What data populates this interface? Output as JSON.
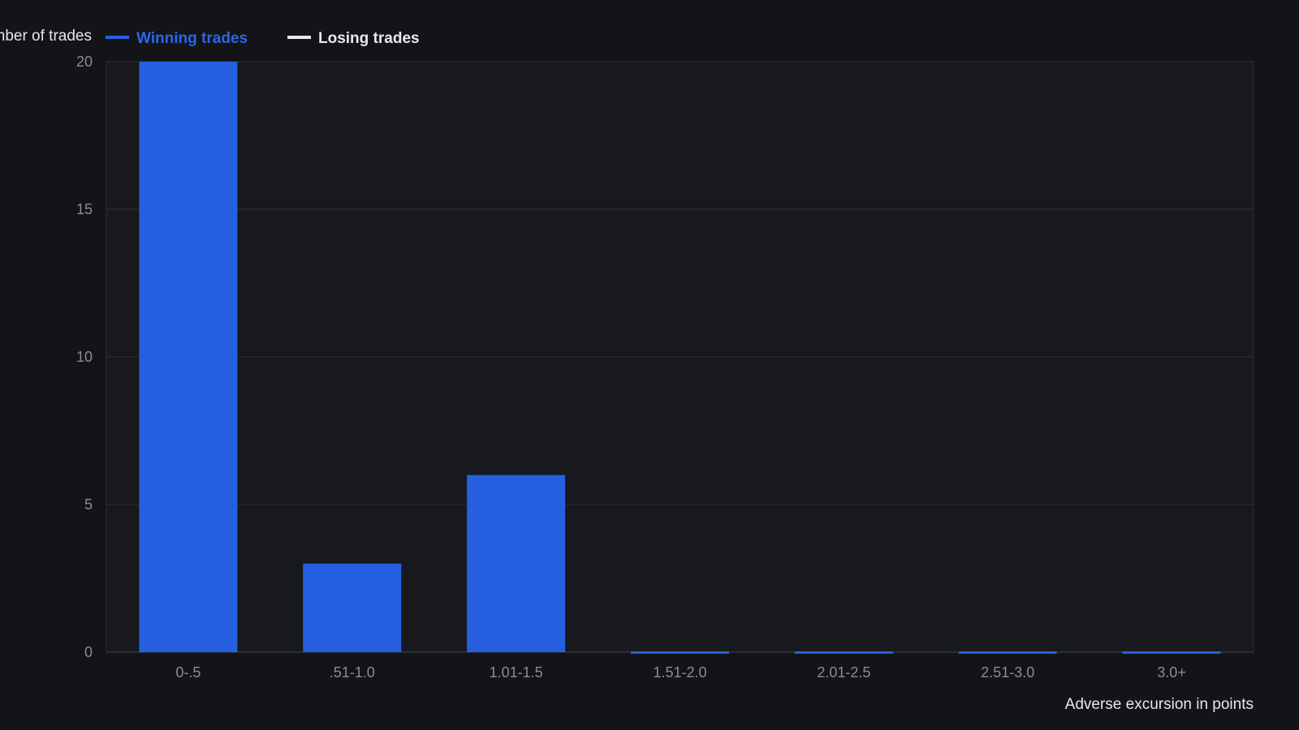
{
  "colors": {
    "page_background": "#121418",
    "plot_background": "#17191d",
    "gridline": "#2b2e34",
    "axis_text": "#8a8d93",
    "title_text": "#e6e7ea",
    "winning": "#2660e0",
    "winning_legend_text": "#2f66e4",
    "losing": "#e9e9eb"
  },
  "chart_data": {
    "type": "bar",
    "ylabel": "Number of trades",
    "xlabel": "Adverse excursion in points",
    "categories": [
      "0-.5",
      ".51-1.0",
      "1.01-1.5",
      "1.51-2.0",
      "2.01-2.5",
      "2.51-3.0",
      "3.0+"
    ],
    "series": [
      {
        "name": "Winning trades",
        "values": [
          20,
          3,
          6,
          0,
          0,
          0,
          0
        ]
      },
      {
        "name": "Losing trades",
        "values": [
          0,
          0,
          0,
          0,
          0,
          0,
          0
        ]
      }
    ],
    "ylim": [
      0,
      20
    ],
    "yticks": [
      0,
      5,
      10,
      15,
      20
    ],
    "grid": true,
    "legend_position": "top-left"
  }
}
